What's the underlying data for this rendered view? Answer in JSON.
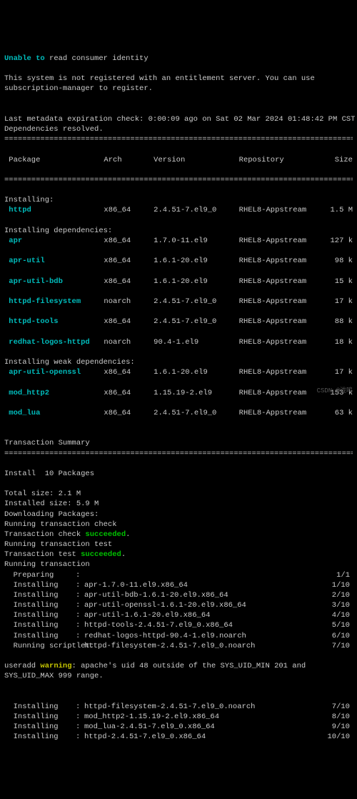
{
  "head": {
    "l1a": "Unable to",
    "l1b": " read consumer identity",
    "blank": " ",
    "l2": "This system is not registered with an entitlement server. You can use subscription-manager to register.",
    "l3": "Last metadata expiration check: 0:00:09 ago on Sat 02 Mar 2024 01:48:42 PM CST.",
    "l4": "Dependencies resolved."
  },
  "hr": "====================================================================================",
  "cols": {
    "pkg": " Package",
    "arch": "Arch",
    "ver": "Version",
    "repo": "Repository",
    "size": "Size"
  },
  "sect": {
    "installing": "Installing:",
    "deps": "Installing dependencies:",
    "weak": "Installing weak dependencies:"
  },
  "rows": {
    "httpd": {
      "pkg": " httpd",
      "arch": "x86_64",
      "ver": "2.4.51-7.el9_0",
      "repo": "RHEL8-Appstream",
      "size": "1.5 M"
    },
    "apr": {
      "pkg": " apr",
      "arch": "x86_64",
      "ver": "1.7.0-11.el9",
      "repo": "RHEL8-Appstream",
      "size": "127 k"
    },
    "aprutil": {
      "pkg": " apr-util",
      "arch": "x86_64",
      "ver": "1.6.1-20.el9",
      "repo": "RHEL8-Appstream",
      "size": "98 k"
    },
    "aprbdb": {
      "pkg": " apr-util-bdb",
      "arch": "x86_64",
      "ver": "1.6.1-20.el9",
      "repo": "RHEL8-Appstream",
      "size": "15 k"
    },
    "httpdfs": {
      "pkg": " httpd-filesystem",
      "arch": "noarch",
      "ver": "2.4.51-7.el9_0",
      "repo": "RHEL8-Appstream",
      "size": "17 k"
    },
    "httpdt": {
      "pkg": " httpd-tools",
      "arch": "x86_64",
      "ver": "2.4.51-7.el9_0",
      "repo": "RHEL8-Appstream",
      "size": "88 k"
    },
    "rhlogo": {
      "pkg": " redhat-logos-httpd",
      "arch": "noarch",
      "ver": "90.4-1.el9",
      "repo": "RHEL8-Appstream",
      "size": "18 k"
    },
    "aprossl": {
      "pkg": " apr-util-openssl",
      "arch": "x86_64",
      "ver": "1.6.1-20.el9",
      "repo": "RHEL8-Appstream",
      "size": "17 k"
    },
    "modhttp2": {
      "pkg": " mod_http2",
      "arch": "x86_64",
      "ver": "1.15.19-2.el9",
      "repo": "RHEL8-Appstream",
      "size": "153 k"
    },
    "modlua": {
      "pkg": " mod_lua",
      "arch": "x86_64",
      "ver": "2.4.51-7.el9_0",
      "repo": "RHEL8-Appstream",
      "size": "63 k"
    }
  },
  "summary": {
    "title": "Transaction Summary",
    "install": "Install  10 Packages",
    "total": "Total size: 2.1 M",
    "isize": "Installed size: 5.9 M",
    "dl": "Downloading Packages:",
    "rtc": "Running transaction check",
    "tcs_a": "Transaction check ",
    "tcs_b": "succeeded",
    "tcs_c": ".",
    "rtt": "Running transaction test",
    "tts_a": "Transaction test ",
    "tts_b": "succeeded",
    "tts_c": ".",
    "rt": "Running transaction"
  },
  "prog": [
    {
      "label": "  Preparing",
      "sep": ":",
      "name": "",
      "count": "1/1"
    },
    {
      "label": "  Installing",
      "sep": ":",
      "name": "apr-1.7.0-11.el9.x86_64",
      "count": "1/10"
    },
    {
      "label": "  Installing",
      "sep": ":",
      "name": "apr-util-bdb-1.6.1-20.el9.x86_64",
      "count": "2/10"
    },
    {
      "label": "  Installing",
      "sep": ":",
      "name": "apr-util-openssl-1.6.1-20.el9.x86_64",
      "count": "3/10"
    },
    {
      "label": "  Installing",
      "sep": ":",
      "name": "apr-util-1.6.1-20.el9.x86_64",
      "count": "4/10"
    },
    {
      "label": "  Installing",
      "sep": ":",
      "name": "httpd-tools-2.4.51-7.el9_0.x86_64",
      "count": "5/10"
    },
    {
      "label": "  Installing",
      "sep": ":",
      "name": "redhat-logos-httpd-90.4-1.el9.noarch",
      "count": "6/10"
    },
    {
      "label": "  Running scriptlet:",
      "sep": "",
      "name": "httpd-filesystem-2.4.51-7.el9_0.noarch",
      "count": "7/10"
    }
  ],
  "warn": {
    "a": "useradd ",
    "b": "warning",
    "c": ": apache's uid 48 outside of the SYS_UID_MIN 201 and SYS_UID_MAX 999 range."
  },
  "prog2": [
    {
      "label": "  Installing",
      "sep": ":",
      "name": "httpd-filesystem-2.4.51-7.el9_0.noarch",
      "count": "7/10"
    },
    {
      "label": "  Installing",
      "sep": ":",
      "name": "mod_http2-1.15.19-2.el9.x86_64",
      "count": "8/10"
    },
    {
      "label": "  Installing",
      "sep": ":",
      "name": "mod_lua-2.4.51-7.el9_0.x86_64",
      "count": "9/10"
    },
    {
      "label": "  Installing",
      "sep": ":",
      "name": "httpd-2.4.51-7.el9_0.x86_64",
      "count": "10/10"
    }
  ],
  "watermark": "CSDN @泷鸣"
}
